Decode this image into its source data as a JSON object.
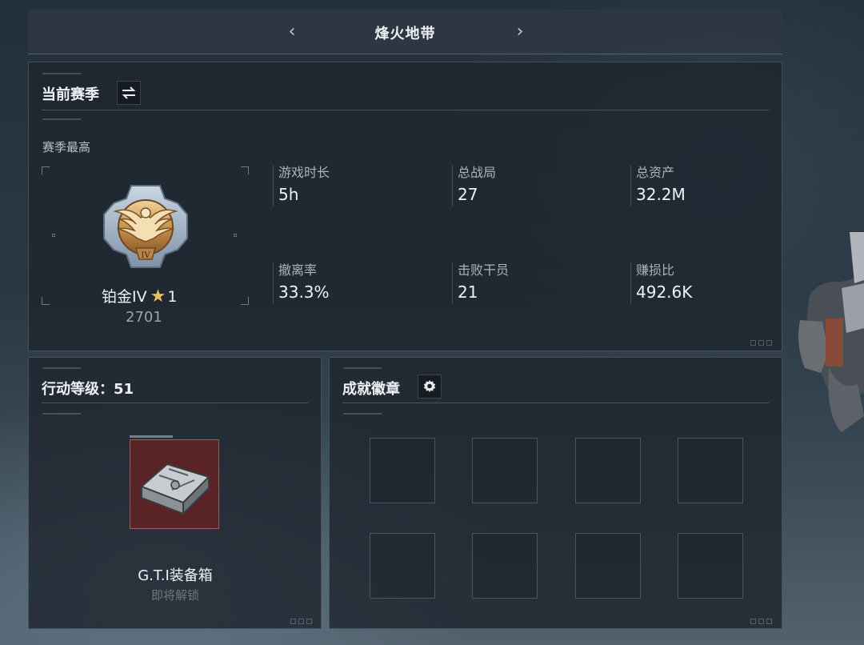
{
  "header": {
    "title": "烽火地带",
    "prev_icon": "chevron-left-icon",
    "next_icon": "chevron-right-icon"
  },
  "season_panel": {
    "title": "当前赛季",
    "switch_icon": "swap-arrows-icon",
    "best_label": "赛季最高",
    "rank": {
      "name": "铂金IV",
      "stars": "1",
      "star_icon": "star-icon",
      "score": "2701",
      "badge_icon": "eagle-rank-badge-icon"
    },
    "stats": [
      {
        "label": "游戏时长",
        "value": "5h"
      },
      {
        "label": "总战局",
        "value": "27"
      },
      {
        "label": "总资产",
        "value": "32.2M"
      },
      {
        "label": "撤离率",
        "value": "33.3%"
      },
      {
        "label": "击败干员",
        "value": "21"
      },
      {
        "label": "赚损比",
        "value": "492.6K"
      }
    ]
  },
  "level_panel": {
    "title": "行动等级：51",
    "reward": {
      "name": "G.T.I装备箱",
      "status": "即将解锁",
      "icon": "equipment-case-icon",
      "bg_color": "#5a2426"
    }
  },
  "badges_panel": {
    "title": "成就徽章",
    "settings_icon": "gear-icon",
    "slot_count": 8
  },
  "colors": {
    "accent_star": "#e8c25a",
    "panel_bg": "#1e262e",
    "text_primary": "#eef2f5",
    "text_muted": "#aab3bc"
  }
}
